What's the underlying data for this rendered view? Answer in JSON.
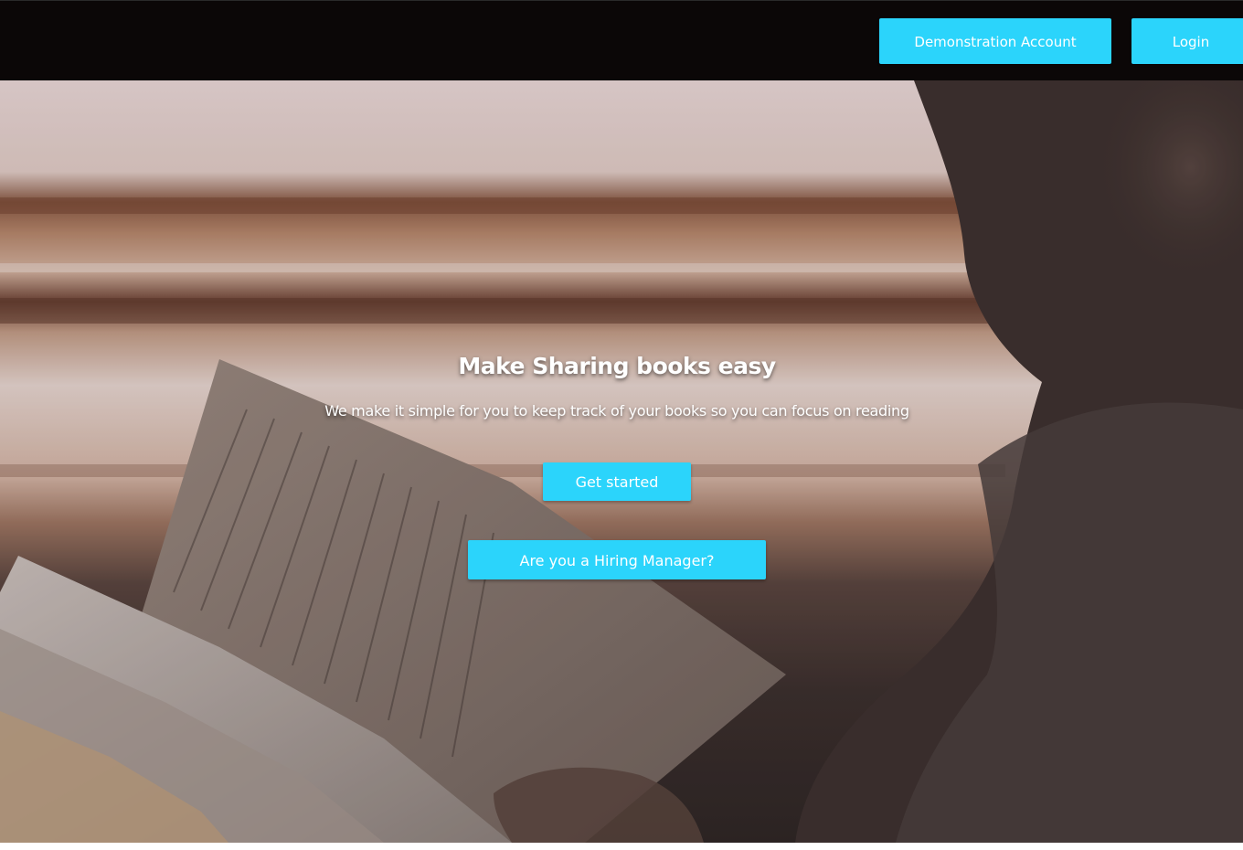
{
  "navbar": {
    "demo_label": "Demonstration Account",
    "login_label": "Login"
  },
  "hero": {
    "title": "Make Sharing books easy",
    "subtitle": "We make it simple for you to keep track of your books so you can focus on reading",
    "get_started_label": "Get started",
    "hiring_label": "Are you a Hiring Manager?"
  },
  "colors": {
    "accent": "#2bd4fb",
    "navbar_bg": "#0b0707",
    "text": "#ffffff"
  }
}
